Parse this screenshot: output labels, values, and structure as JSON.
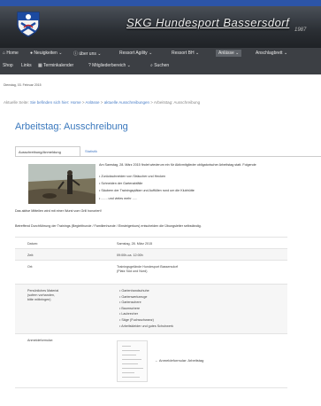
{
  "header": {
    "site_title": "SKG Hundesport Bassersdorf",
    "year": "1987"
  },
  "nav": {
    "row1": [
      "Home",
      "Neuigkeiten",
      "über uns",
      "Ressort Agility",
      "Ressort BH",
      "Anlässe",
      "Anschlagbrett"
    ],
    "row2": [
      "Shop",
      "Links",
      "Terminkalender",
      "Mitgliederbereich",
      "Suchen"
    ]
  },
  "date": "Dienstag, 03. Februar 2015",
  "breadcrumb": {
    "prefix": "Aktuelle Seite:",
    "items": [
      "Sie befinden sich hier: Home",
      "Anlässe",
      "aktuelle Ausschreibungen",
      "Arbeitstag: Ausschreibung"
    ],
    "separator": ">"
  },
  "page_title": "Arbeitstag: Ausschreibung",
  "tabs": [
    "Ausschreibung/Anmeldung",
    "Statistik"
  ],
  "intro": "Am Samstag, 28. März 2015 findet wiederum ein für Aktivmitglieder obligatorischer Arbeitstag statt. Folgende",
  "bullets": [
    "Zurückschneiden von Sträucher und Hecken",
    "Schneiden der Gartenabfälle",
    "Säubern der Trainingsplätze und Auffüllen rund um die Klubhütte",
    "....... und vieles mehr ....."
  ],
  "para1": "Das aktive Mitteilen wird mit einer Wurst vom Grill honoriert!",
  "para2": "Betreffend Durchführung der Trainings (Begleithunde / Familienhunde / Einsteigerkurs) entscheiden die Übungsleiter selbständig.",
  "details": {
    "datum_label": "Datum:",
    "datum_value": "Samstag, 28. März 2015",
    "zeit_label": "Zeit:",
    "zeit_value": "09:00h-ca. 12:00h",
    "ort_label": "Ort:",
    "ort_value_1": "Trainingsgelände Hundesport Bassersdorf",
    "ort_value_2": "(Platz Süd und Nord)",
    "material_label_1": "Persönliches Material",
    "material_label_2": "(sofern vorhanden,",
    "material_label_3": "bitte mitbringen)",
    "material_items": [
      "Gartenhandschuhe",
      "Gartenwerkzeuge",
      "Gartenschere",
      "Baumschere",
      "Laubrecher",
      "Säge (Fuchsschwanz)",
      "Arbeitskleider und gutes Schuhwerk"
    ],
    "form_label": "Anmeldeformular:",
    "form_caption": "Anmeldeformular: Arbeitstag"
  },
  "colors": {
    "header_dark": "#1c1f24",
    "header_blue": "#2c55a8",
    "navbar": "#3c3f44",
    "link_blue": "#4a7ec7",
    "title_blue": "#3a78bd"
  }
}
